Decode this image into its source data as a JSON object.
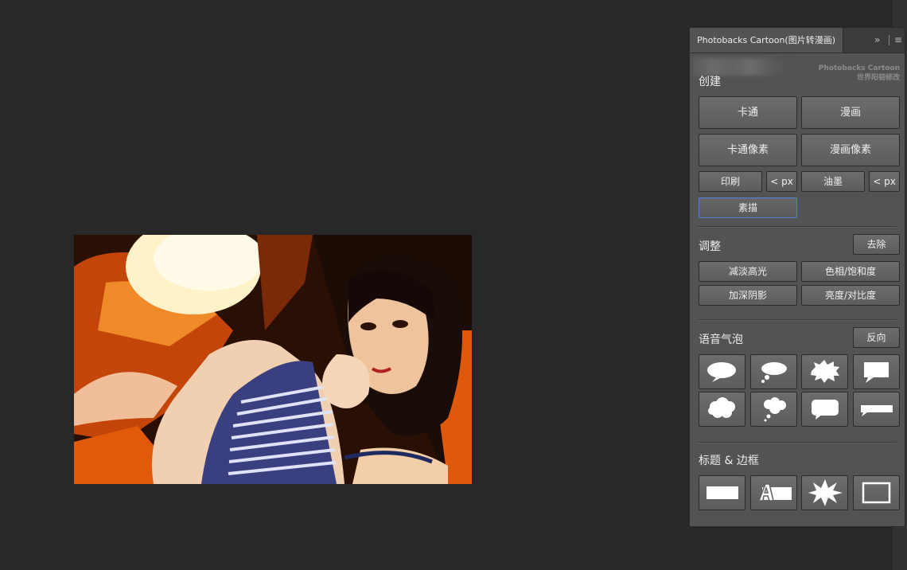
{
  "panel": {
    "tab_title": "Photobacks Cartoon(图片转漫画)",
    "expand_icon": "double-chevron-right-icon",
    "menu_icon": "hamburger-menu-icon",
    "brand_line1": "Photobacks Cartoon",
    "brand_line2": "世界阳韧修改"
  },
  "create": {
    "title": "创建",
    "cartoon": "卡通",
    "comic": "漫画",
    "cartoon_pixel": "卡通像素",
    "comic_pixel": "漫画像素",
    "print": "印刷",
    "print_px": "< px",
    "ink": "油墨",
    "ink_px": "< px",
    "sketch": "素描"
  },
  "adjust": {
    "title": "调整",
    "remove": "去除",
    "reduce_highlights": "减淡高光",
    "hue_saturation": "色相/饱和度",
    "deepen_shadows": "加深阴影",
    "brightness_contrast": "亮度/对比度"
  },
  "bubbles": {
    "title": "语音气泡",
    "reverse": "反向",
    "icons": [
      "oval-speech-bubble-icon",
      "thought-bubble-icon",
      "shout-burst-bubble-icon",
      "rectangle-speech-bubble-icon",
      "cloud-bubble-icon",
      "small-thought-bubble-icon",
      "rounded-rect-bubble-icon",
      "banner-caption-icon"
    ]
  },
  "titles": {
    "title": "标题 & 边框",
    "icons": [
      "caption-box-icon",
      "text-caption-icon",
      "burst-frame-icon",
      "border-frame-icon"
    ]
  },
  "colors": {
    "workspace": "#282828",
    "panel": "#535353",
    "selected_border": "#4f7fd0"
  }
}
